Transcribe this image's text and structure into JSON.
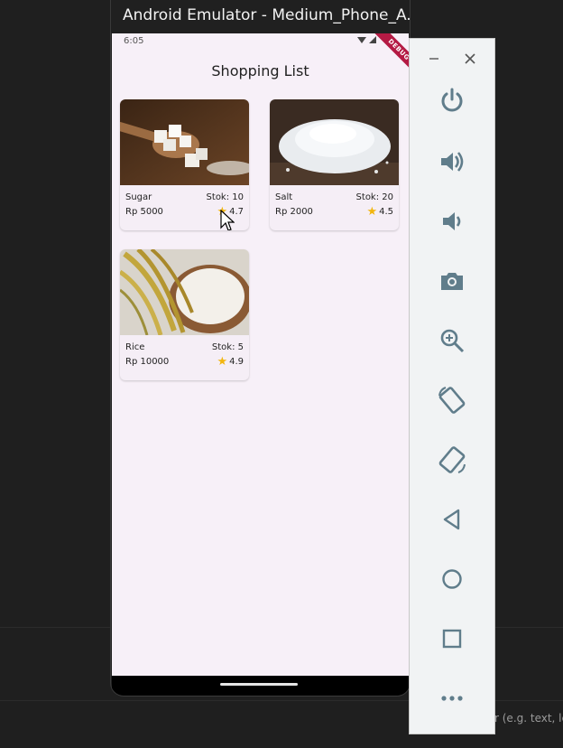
{
  "window": {
    "title": "Android Emulator - Medium_Phone_A..."
  },
  "status_bar": {
    "time": "6:05",
    "debug_banner": "DEBUG"
  },
  "app": {
    "title": "Shopping List",
    "products": [
      {
        "name": "Sugar",
        "stock": "Stok: 10",
        "price": "Rp 5000",
        "rating": "4.7"
      },
      {
        "name": "Salt",
        "stock": "Stok: 20",
        "price": "Rp 2000",
        "rating": "4.5"
      },
      {
        "name": "Rice",
        "stock": "Stok: 5",
        "price": "Rp 10000",
        "rating": "4.9"
      }
    ]
  },
  "toolbar": {
    "buttons": [
      "minimize-icon",
      "close-icon",
      "power-icon",
      "volume-up-icon",
      "volume-down-icon",
      "camera-icon",
      "zoom-icon",
      "rotate-left-icon",
      "rotate-right-icon",
      "back-icon",
      "home-icon",
      "overview-icon",
      "more-icon"
    ]
  },
  "background": {
    "search_hint": "r (e.g. text, le"
  },
  "colors": {
    "accent": "#b41a44",
    "star": "#f2b60f",
    "screen_bg": "#f7f0f8",
    "toolbar_icon": "#607d8b"
  }
}
